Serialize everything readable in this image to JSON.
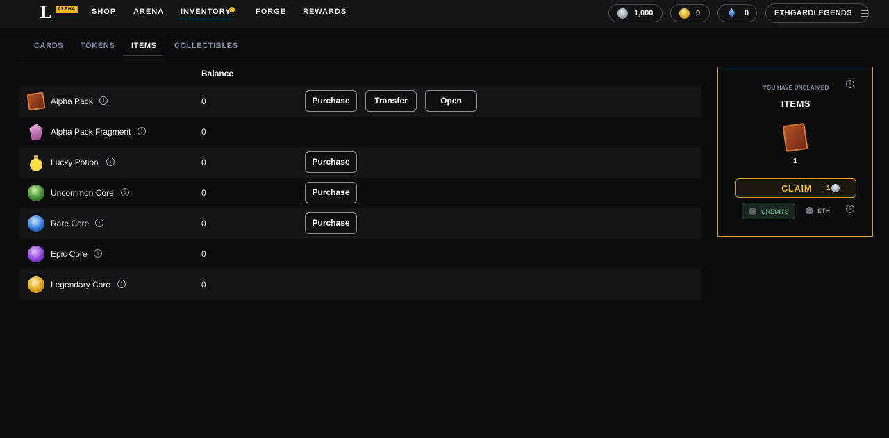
{
  "header": {
    "logo_letter": "L",
    "badge": "ALPHA",
    "nav": [
      "SHOP",
      "ARENA",
      "INVENTORY",
      "FORGE",
      "REWARDS"
    ],
    "active_nav": "INVENTORY",
    "balances": {
      "silver": "1,000",
      "gold": "0",
      "gems": "0"
    },
    "account": "ETHGARDLEGENDS"
  },
  "tabs": [
    "CARDS",
    "TOKENS",
    "ITEMS",
    "COLLECTIBLES"
  ],
  "active_tab": "ITEMS",
  "table": {
    "balance_header": "Balance",
    "rows": [
      {
        "name": "Alpha Pack",
        "balance": "0",
        "icon": "alpha-pack-icon",
        "buttons": [
          "Purchase",
          "Transfer",
          "Open"
        ]
      },
      {
        "name": "Alpha Pack Fragment",
        "balance": "0",
        "icon": "pack-fragment-icon",
        "buttons": []
      },
      {
        "name": "Lucky Potion",
        "balance": "0",
        "icon": "potion-icon",
        "buttons": [
          "Purchase"
        ]
      },
      {
        "name": "Uncommon Core",
        "balance": "0",
        "icon": "uncommon-core-icon",
        "buttons": [
          "Purchase"
        ]
      },
      {
        "name": "Rare Core",
        "balance": "0",
        "icon": "rare-core-icon",
        "buttons": [
          "Purchase"
        ]
      },
      {
        "name": "Epic Core",
        "balance": "0",
        "icon": "epic-core-icon",
        "buttons": []
      },
      {
        "name": "Legendary Core",
        "balance": "0",
        "icon": "legendary-core-icon",
        "buttons": []
      }
    ]
  },
  "claim_panel": {
    "subtitle": "YOU HAVE UNCLAIMED",
    "title": "ITEMS",
    "quantity": "1",
    "claim_label": "CLAIM",
    "claim_cost": "1",
    "currency_options": [
      "CREDITS",
      "ETH"
    ],
    "selected_currency": "CREDITS"
  },
  "colors": {
    "accent": "#d6a623",
    "tab_inactive": "#8592a6",
    "credits_green": "#4c9e73"
  }
}
